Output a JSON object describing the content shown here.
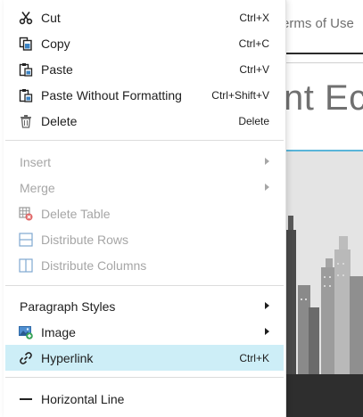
{
  "background": {
    "top_link": "erms of Use",
    "heading": "nt Ec"
  },
  "menu": {
    "items": [
      {
        "label": "Cut",
        "shortcut": "Ctrl+X",
        "icon": "scissors-icon",
        "enabled": true
      },
      {
        "label": "Copy",
        "shortcut": "Ctrl+C",
        "icon": "copy-icon",
        "enabled": true
      },
      {
        "label": "Paste",
        "shortcut": "Ctrl+V",
        "icon": "paste-icon",
        "enabled": true
      },
      {
        "label": "Paste Without Formatting",
        "shortcut": "Ctrl+Shift+V",
        "icon": "paste-plain-icon",
        "enabled": true
      },
      {
        "label": "Delete",
        "shortcut": "Delete",
        "icon": "trash-icon",
        "enabled": true
      },
      {
        "label": "Insert",
        "submenu": true,
        "enabled": false
      },
      {
        "label": "Merge",
        "submenu": true,
        "enabled": false
      },
      {
        "label": "Delete Table",
        "icon": "delete-table-icon",
        "enabled": false
      },
      {
        "label": "Distribute Rows",
        "icon": "distribute-rows-icon",
        "enabled": false
      },
      {
        "label": "Distribute Columns",
        "icon": "distribute-columns-icon",
        "enabled": false
      },
      {
        "label": "Paragraph Styles",
        "submenu": true,
        "enabled": true
      },
      {
        "label": "Image",
        "icon": "image-add-icon",
        "submenu": true,
        "enabled": true
      },
      {
        "label": "Hyperlink",
        "shortcut": "Ctrl+K",
        "icon": "link-icon",
        "enabled": true,
        "highlighted": true
      },
      {
        "label": "Horizontal Line",
        "icon": "horizontal-line-icon",
        "enabled": true
      }
    ]
  },
  "colors": {
    "highlight": "#cdeef7",
    "disabled_text": "#a6a6a6",
    "accent_line": "#59b5d9"
  }
}
